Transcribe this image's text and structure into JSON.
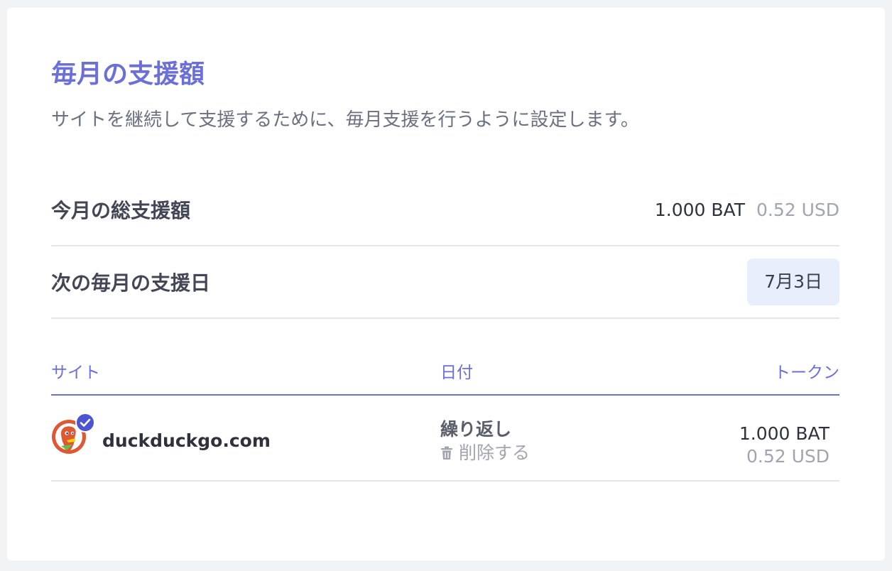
{
  "page": {
    "title": "毎月の支援額",
    "description": "サイトを継続して支援するために、毎月支援を行うように設定します。"
  },
  "summary": {
    "total_label": "今月の総支援額",
    "total_bat": "1.000 BAT",
    "total_usd": "0.52 USD",
    "next_label": "次の毎月の支援日",
    "next_date": "7月3日"
  },
  "table": {
    "headers": {
      "site": "サイト",
      "date": "日付",
      "tokens": "トークン"
    },
    "rows": [
      {
        "site": "duckduckgo.com",
        "favicon_icon": "duckduckgo-logo-icon",
        "verified_icon": "verified-check-icon",
        "schedule": "繰り返し",
        "remove_label": "削除する",
        "remove_icon": "trash-icon",
        "bat": "1.000 BAT",
        "usd": "0.52 USD"
      }
    ]
  },
  "colors": {
    "accent": "#6b6fd8",
    "verified_badge": "#4c54d2",
    "pill_bg": "#e9eefc",
    "muted_text": "#a2a5b0"
  }
}
